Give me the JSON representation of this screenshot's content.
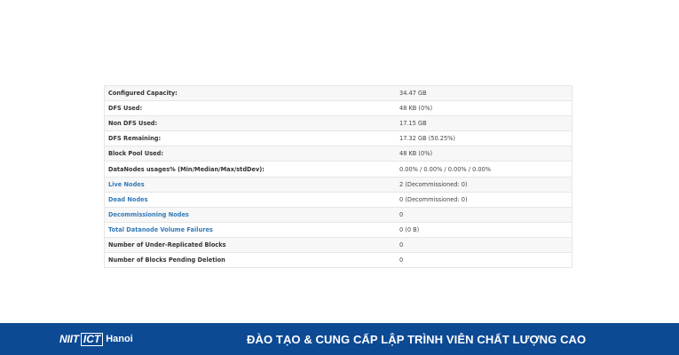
{
  "summary": {
    "rows": [
      {
        "label": "Configured Capacity:",
        "value": "34.47 GB",
        "link": false
      },
      {
        "label": "DFS Used:",
        "value": "48 KB (0%)",
        "link": false
      },
      {
        "label": "Non DFS Used:",
        "value": "17.15 GB",
        "link": false
      },
      {
        "label": "DFS Remaining:",
        "value": "17.32 GB (50.25%)",
        "link": false
      },
      {
        "label": "Block Pool Used:",
        "value": "48 KB (0%)",
        "link": false
      },
      {
        "label": "DataNodes usages% (Min/Median/Max/stdDev):",
        "value": "0.00% / 0.00% / 0.00% / 0.00%",
        "link": false
      },
      {
        "label": "Live Nodes",
        "value": "2 (Decommissioned: 0)",
        "link": true
      },
      {
        "label": "Dead Nodes",
        "value": "0 (Decommissioned: 0)",
        "link": true
      },
      {
        "label": "Decommissioning Nodes",
        "value": "0",
        "link": true
      },
      {
        "label": "Total Datanode Volume Failures",
        "value": "0 (0 B)",
        "link": true
      },
      {
        "label": "Number of Under-Replicated Blocks",
        "value": "0",
        "link": false
      },
      {
        "label": "Number of Blocks Pending Deletion",
        "value": "0",
        "link": false
      }
    ]
  },
  "footer": {
    "logo_part1": "NIIT",
    "logo_part2": "ICT",
    "logo_city": "Hanoi",
    "slogan": "ĐÀO TẠO & CUNG CẤP LẬP TRÌNH VIÊN CHẤT LƯỢNG CAO"
  },
  "colors": {
    "footer_bg": "#0d4a94",
    "link": "#337ab7"
  }
}
